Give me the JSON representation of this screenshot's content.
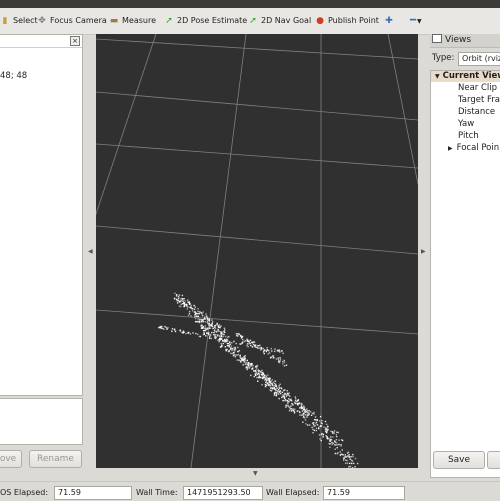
{
  "toolbar": {
    "tools": [
      {
        "label": "Select"
      },
      {
        "label": "Focus Camera"
      },
      {
        "label": "Measure"
      },
      {
        "label": "2D Pose Estimate"
      },
      {
        "label": "2D Nav Goal"
      },
      {
        "label": "Publish Point"
      }
    ]
  },
  "left_panel": {
    "close_glyph": "×",
    "text_fragment": "48; 48",
    "remove_label": "ove",
    "rename_label": "Rename"
  },
  "views_panel": {
    "title": "Views",
    "type_label": "Type:",
    "type_value": "Orbit (rviz)",
    "tree": {
      "header": "Current View",
      "items": [
        "Near Clip ...",
        "Target Fra",
        "Distance",
        "Yaw",
        "Pitch",
        "Focal Poin"
      ]
    },
    "save_label": "Save"
  },
  "status_bar": {
    "ros_elapsed_label": "OS Elapsed:",
    "ros_elapsed_value": "71.59",
    "wall_time_label": "Wall Time:",
    "wall_time_value": "1471951293.50",
    "wall_elapsed_label": "Wall Elapsed:",
    "wall_elapsed_value": "71.59"
  },
  "colors": {
    "viewport_bg": "#303030",
    "grid": "#a0a0a0",
    "pointcloud": "#ffffff",
    "selected_row": "#e8dcc8"
  }
}
